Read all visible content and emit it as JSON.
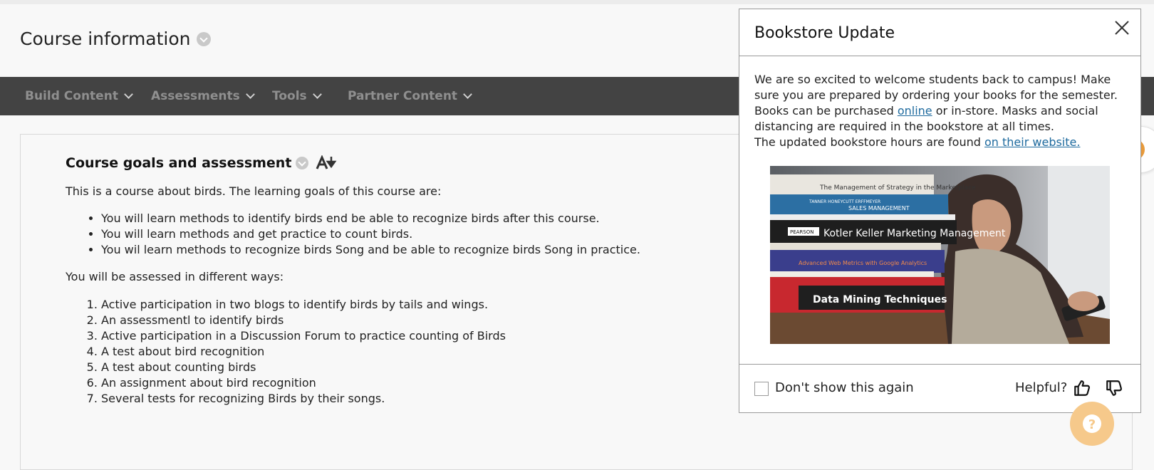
{
  "header": {
    "page_title": "Course information"
  },
  "nav": {
    "items": [
      {
        "label": "Build Content"
      },
      {
        "label": "Assessments"
      },
      {
        "label": "Tools"
      },
      {
        "label": "Partner Content"
      }
    ]
  },
  "content": {
    "section_title": "Course goals and assessment",
    "intro": "This is a course about birds.  The learning goals of this course are:",
    "goals": [
      "You will learn methods to identify birds end be able to recognize birds after this course.",
      "You will learn methods and get practice to count birds.",
      "You wil learn methods to recognize birds Song and be able to recognize birds Song in practice."
    ],
    "assessment_intro": "You will be assessed in different ways:",
    "assessments": [
      "Active participation in two blogs to identify birds by tails and wings.",
      "An assessmentl to identify birds",
      "Active participation in a Discussion Forum to practice counting of Birds",
      "A test about bird recognition",
      "A test about counting birds",
      "An assignment about bird recognition",
      "Several tests for recognizing Birds by their songs."
    ]
  },
  "modal": {
    "title": "Bookstore Update",
    "body_part1": "We are so excited to welcome students back to campus! Make sure you are prepared by ordering your books for the semester. Books can be purchased ",
    "link_online": "online",
    "body_part2": " or in-store. Masks and social distancing are required in the bookstore at all times.",
    "body_part3": "The updated bookstore hours are found ",
    "link_website": "on their website.",
    "image": {
      "book_titles": [
        "The Management of Strategy in the Marketplace",
        "SALES MANAGEMENT",
        "Kotler Keller Marketing Management",
        "Advanced Web Metrics with Google Analytics",
        "Data Mining Techniques"
      ],
      "book_authors": "TANNER HONEYCUTT ERFFMEYER",
      "publisher": "PEARSON"
    },
    "footer": {
      "dont_show_label": "Don't show this again",
      "helpful_label": "Helpful?"
    }
  },
  "colors": {
    "nav_bg": "#434343",
    "link": "#1e6a9e",
    "help_button": "#f6c98b",
    "side_tab_icon": "#e89a3a"
  },
  "icons": {
    "close": "close-icon",
    "thumbs_up": "thumbs-up-icon",
    "thumbs_down": "thumbs-down-icon",
    "help": "question-mark-icon",
    "side_tab": "e-tutor-icon"
  }
}
